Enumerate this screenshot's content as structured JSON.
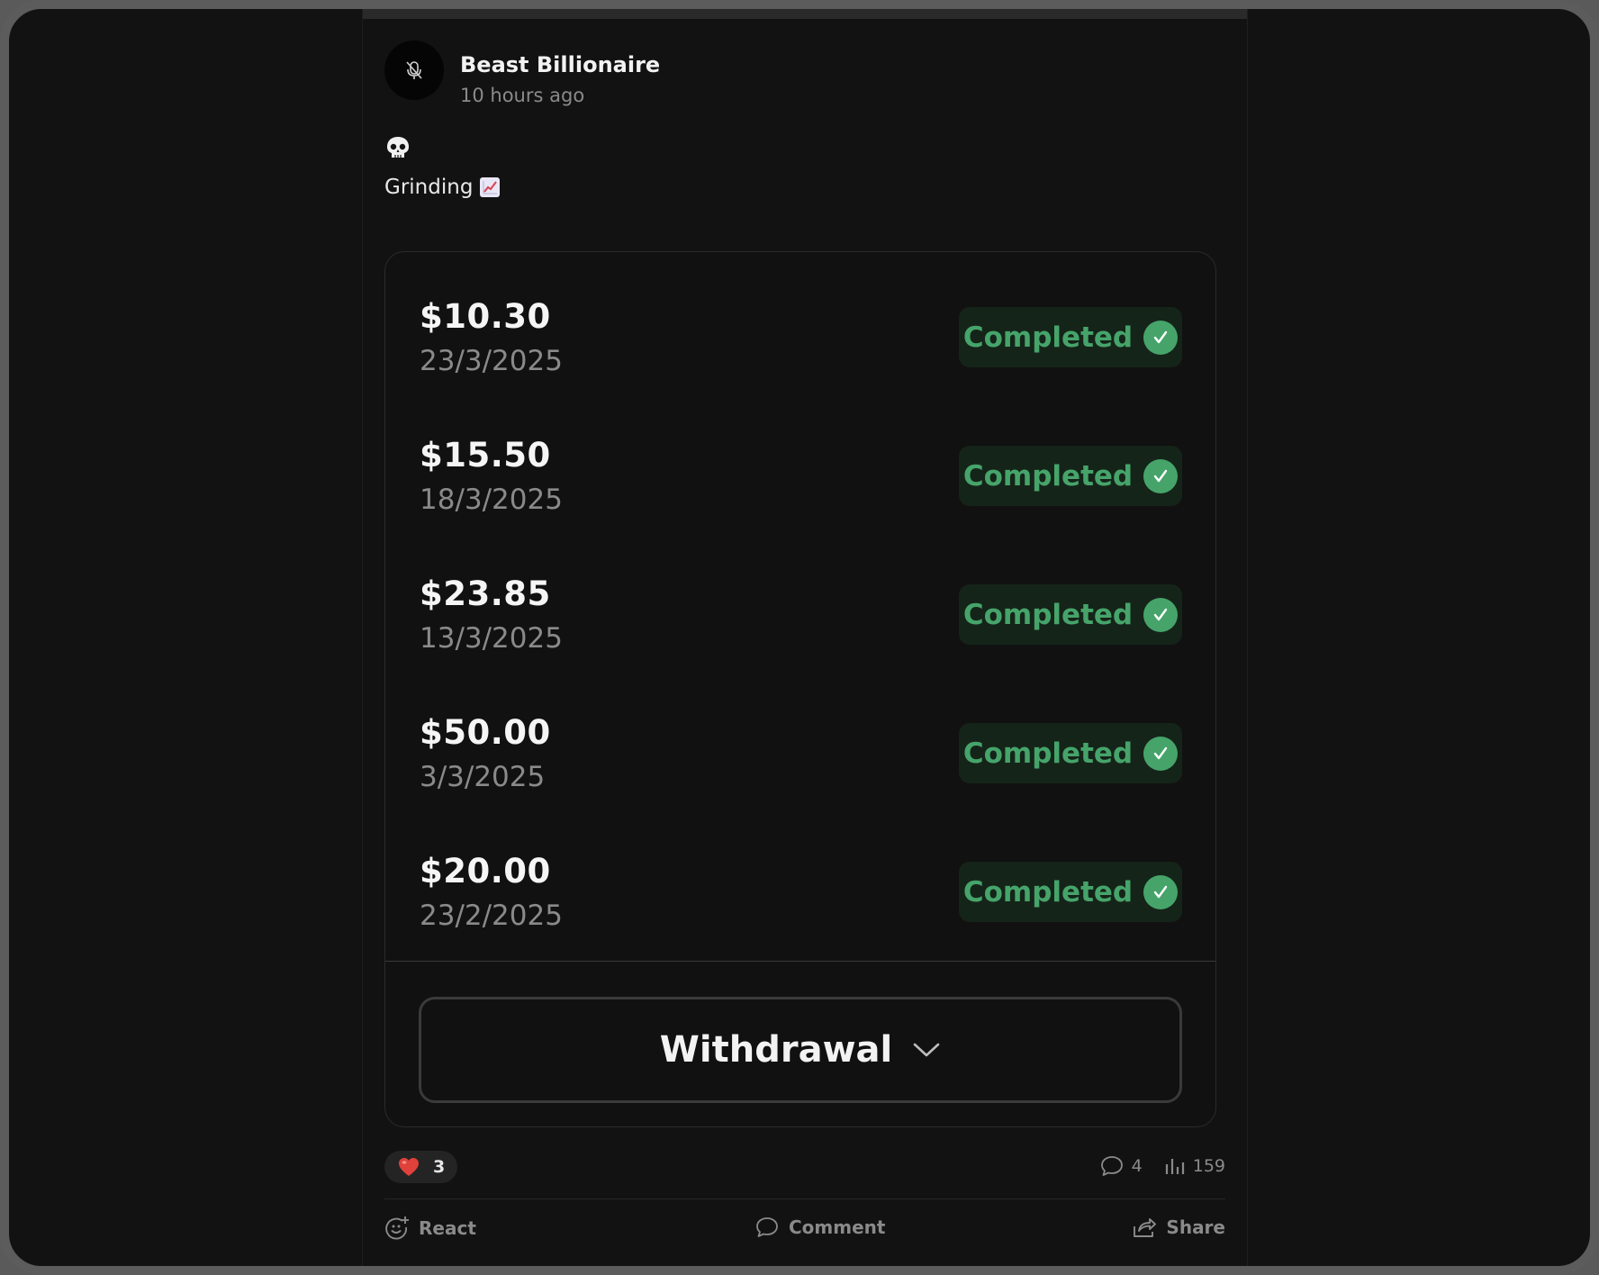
{
  "post": {
    "author": "Beast Billionaire",
    "time": "10 hours ago",
    "emoji_line": "💀",
    "text": "Grinding"
  },
  "transactions": [
    {
      "amount": "$10.30",
      "date": "23/3/2025",
      "status": "Completed"
    },
    {
      "amount": "$15.50",
      "date": "18/3/2025",
      "status": "Completed"
    },
    {
      "amount": "$23.85",
      "date": "13/3/2025",
      "status": "Completed"
    },
    {
      "amount": "$50.00",
      "date": "3/3/2025",
      "status": "Completed"
    },
    {
      "amount": "$20.00",
      "date": "23/2/2025",
      "status": "Completed"
    }
  ],
  "withdraw": {
    "label": "Withdrawal"
  },
  "reactions": {
    "count": "3",
    "icon": "heart-icon"
  },
  "stats": {
    "comments": "4",
    "views": "159"
  },
  "actions": {
    "react": "React",
    "comment": "Comment",
    "share": "Share"
  },
  "colors": {
    "accent_green": "#46a46a",
    "badge_bg": "#152419",
    "background": "#121212"
  }
}
